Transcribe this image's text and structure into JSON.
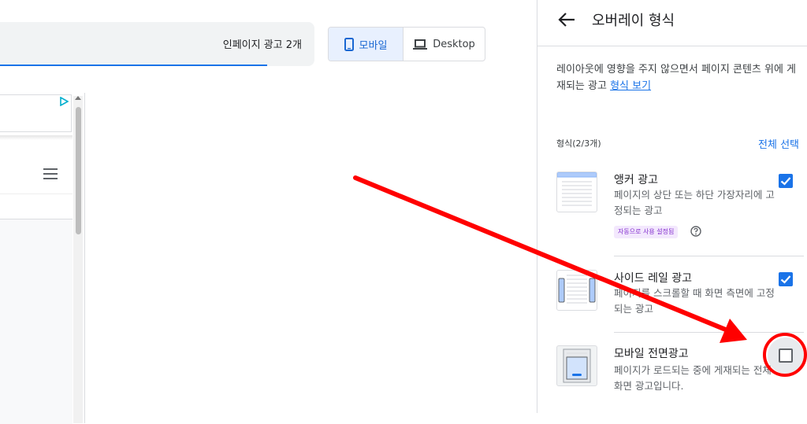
{
  "preview": {
    "ad_summary": "인페이지 광고 2개",
    "device_toggle": {
      "mobile_label": "모바일",
      "desktop_label": "Desktop",
      "selected": "mobile"
    }
  },
  "panel": {
    "title": "오버레이 형식",
    "description": "레이아웃에 영향을 주지 않으면서 페이지 콘텐츠 위에 게재되는 광고",
    "description_link": "형식 보기",
    "formats_count_label": "형식(2/3개)",
    "select_all_label": "전체 선택",
    "formats": [
      {
        "title": "앵커 광고",
        "description": "페이지의 상단 또는 하단 가장자리에 고정되는 광고",
        "checked": true,
        "badge": "자동으로 사용 설정됨"
      },
      {
        "title": "사이드 레일 광고",
        "description": "페이지를 스크롤할 때 화면 측면에 고정되는 광고",
        "checked": true
      },
      {
        "title": "모바일 전면광고",
        "description": "페이지가 로드되는 중에 게재되는 전체 화면 광고입니다.",
        "checked": false
      }
    ]
  },
  "colors": {
    "accent": "#1a73e8",
    "annotation": "#ff0000"
  },
  "icons": [
    "phone-icon",
    "laptop-icon",
    "back-arrow-icon",
    "help-icon",
    "adchoices-icon",
    "hamburger-menu-icon"
  ]
}
